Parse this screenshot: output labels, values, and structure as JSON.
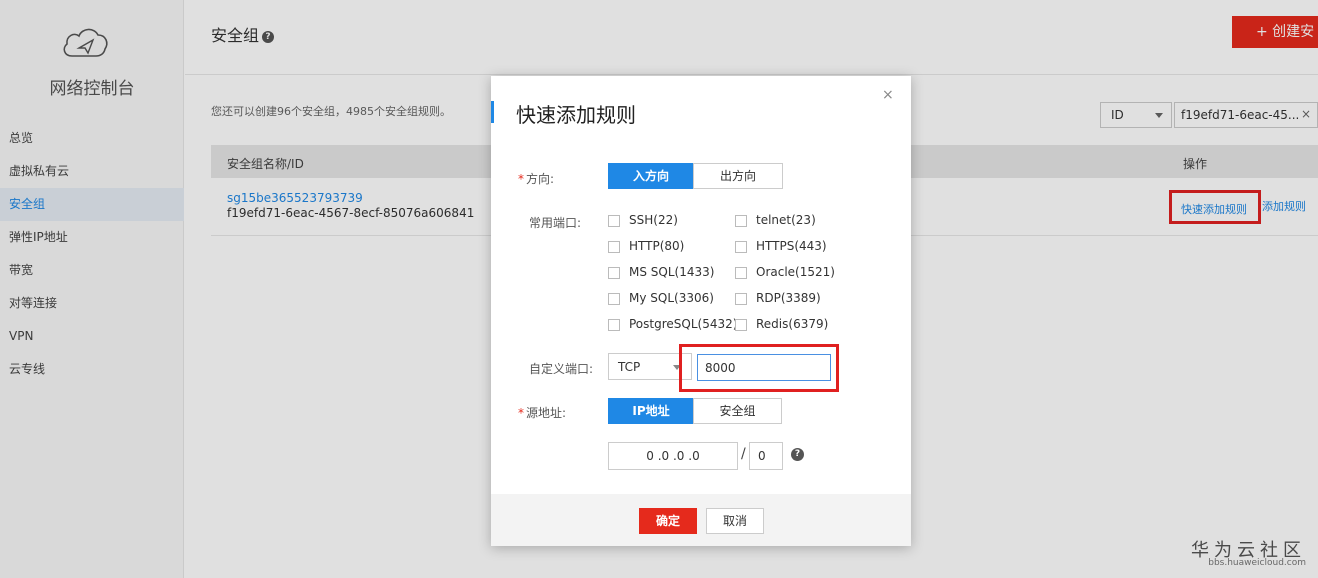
{
  "sidebar": {
    "console_title": "网络控制台",
    "items": [
      {
        "label": "总览",
        "active": false
      },
      {
        "label": "虚拟私有云",
        "active": false
      },
      {
        "label": "安全组",
        "active": true
      },
      {
        "label": "弹性IP地址",
        "active": false
      },
      {
        "label": "带宽",
        "active": false
      },
      {
        "label": "对等连接",
        "active": false
      },
      {
        "label": "VPN",
        "active": false
      },
      {
        "label": "云专线",
        "active": false
      }
    ]
  },
  "header": {
    "title": "安全组",
    "help_glyph": "?",
    "create_label": "+ 创建安"
  },
  "main": {
    "quota_text": "您还可以创建96个安全组，4985个安全组规则。",
    "filter": {
      "field": "ID",
      "value": "f19efd71-6eac-45...",
      "clear_glyph": "×"
    },
    "table": {
      "columns": [
        "安全组名称/ID",
        "操作"
      ],
      "rows": [
        {
          "name": "sg15be365523793739",
          "id": "f19efd71-6eac-4567-8ecf-85076a606841",
          "actions": [
            "快速添加规则",
            "添加规则"
          ]
        }
      ]
    }
  },
  "modal": {
    "title": "快速添加规则",
    "close_glyph": "×",
    "direction": {
      "label": "方向:",
      "options": [
        "入方向",
        "出方向"
      ],
      "selected": "入方向"
    },
    "common_ports": {
      "label": "常用端口:",
      "options": [
        "SSH(22)",
        "telnet(23)",
        "HTTP(80)",
        "HTTPS(443)",
        "MS SQL(1433)",
        "Oracle(1521)",
        "My SQL(3306)",
        "RDP(3389)",
        "PostgreSQL(5432)",
        "Redis(6379)"
      ]
    },
    "custom_port": {
      "label": "自定义端口:",
      "protocol": "TCP",
      "value": "8000"
    },
    "source": {
      "label": "源地址:",
      "options": [
        "IP地址",
        "安全组"
      ],
      "selected": "IP地址",
      "ip_value": "0 .0 .0 .0",
      "slash": "/",
      "mask_value": "0",
      "help_glyph": "?"
    },
    "footer": {
      "ok_label": "确定",
      "cancel_label": "取消"
    }
  },
  "watermark": {
    "main": "华为云社区",
    "sub": "bbs.huaweicloud.com"
  },
  "colors": {
    "accent_blue": "#1f88e5",
    "brand_red": "#e52a1c",
    "highlight_red": "#e02020"
  },
  "icons": {
    "logo": "cloud-icon",
    "caret": "chevron-down-icon",
    "help": "question-circle-icon"
  }
}
